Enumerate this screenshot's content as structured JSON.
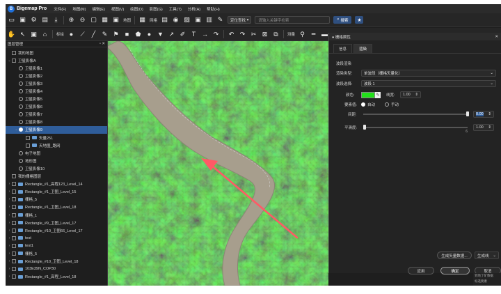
{
  "app": {
    "logo_letter": "B",
    "title": "Bigemap Pro"
  },
  "menu": [
    "文件(F)",
    "地图(M)",
    "编辑(E)",
    "视图(V)",
    "绘图(D)",
    "影图(G)",
    "工具(T)",
    "分析(A)",
    "帮助(H)"
  ],
  "toolbar1": {
    "map_label": "地图",
    "grid_label": "网格",
    "locate_select": "定位查找",
    "search_placeholder": "请输入关键字检索",
    "search_button": "搜索"
  },
  "toolbar2": {
    "mark_label": "标绘",
    "measure_label": "测量"
  },
  "sidebar": {
    "title": "图层管理",
    "tree": [
      {
        "label": "我的地图",
        "depth": 0,
        "arrow": "",
        "ctrl": "chk",
        "icon": false,
        "hl": false
      },
      {
        "label": "卫星影像A",
        "depth": 0,
        "arrow": "⌄",
        "ctrl": "chk",
        "icon": false,
        "hl": false
      },
      {
        "label": "卫星影像1",
        "depth": 1,
        "arrow": "",
        "ctrl": "rad",
        "icon": false,
        "hl": false
      },
      {
        "label": "卫星影像2",
        "depth": 1,
        "arrow": "",
        "ctrl": "rad",
        "icon": false,
        "hl": false
      },
      {
        "label": "卫星影像3",
        "depth": 1,
        "arrow": "",
        "ctrl": "rad",
        "icon": false,
        "hl": false
      },
      {
        "label": "卫星影像4",
        "depth": 1,
        "arrow": "",
        "ctrl": "rad",
        "icon": false,
        "hl": false
      },
      {
        "label": "卫星影像5",
        "depth": 1,
        "arrow": "",
        "ctrl": "rad",
        "icon": false,
        "hl": false
      },
      {
        "label": "卫星影像6",
        "depth": 1,
        "arrow": "",
        "ctrl": "rad",
        "icon": false,
        "hl": false
      },
      {
        "label": "卫星影像7",
        "depth": 1,
        "arrow": "",
        "ctrl": "rad",
        "icon": false,
        "hl": false
      },
      {
        "label": "卫星影像8",
        "depth": 1,
        "arrow": "",
        "ctrl": "rad",
        "icon": false,
        "hl": false
      },
      {
        "label": "卫星影像9",
        "depth": 1,
        "arrow": "⌄",
        "ctrl": "rad-on",
        "icon": false,
        "hl": true
      },
      {
        "label": "矢量251",
        "depth": 2,
        "arrow": "",
        "ctrl": "chk",
        "icon": true,
        "hl": false
      },
      {
        "label": "天地图_路网",
        "depth": 2,
        "arrow": "",
        "ctrl": "chk",
        "icon": true,
        "hl": false
      },
      {
        "label": "电子地图",
        "depth": 1,
        "arrow": "",
        "ctrl": "rad",
        "icon": false,
        "hl": false
      },
      {
        "label": "地形图",
        "depth": 1,
        "arrow": "",
        "ctrl": "rad",
        "icon": false,
        "hl": false
      },
      {
        "label": "卫星影像10",
        "depth": 1,
        "arrow": "",
        "ctrl": "rad",
        "icon": false,
        "hl": false
      },
      {
        "label": "我的栅格图层",
        "depth": 0,
        "arrow": "",
        "ctrl": "chk",
        "icon": false,
        "hl": false
      },
      {
        "label": "Rectangle_#1_高程123_Level_14",
        "depth": 0,
        "arrow": "›",
        "ctrl": "chk",
        "icon": true,
        "hl": false
      },
      {
        "label": "Rectangle_#1_卫图_Level_15",
        "depth": 0,
        "arrow": "›",
        "ctrl": "chk",
        "icon": true,
        "hl": false
      },
      {
        "label": "栅格_5",
        "depth": 0,
        "arrow": "›",
        "ctrl": "chk",
        "icon": true,
        "hl": false
      },
      {
        "label": "Rectangle_#1_卫图_Level_18",
        "depth": 0,
        "arrow": "›",
        "ctrl": "chk",
        "icon": true,
        "hl": false
      },
      {
        "label": "栅格_1",
        "depth": 0,
        "arrow": "›",
        "ctrl": "chk",
        "icon": true,
        "hl": false
      },
      {
        "label": "Rectangle_#9_卫图_Level_17",
        "depth": 0,
        "arrow": "›",
        "ctrl": "chk",
        "icon": true,
        "hl": false
      },
      {
        "label": "Rectangle_#10_卫图66_Level_17",
        "depth": 0,
        "arrow": "›",
        "ctrl": "chk",
        "icon": true,
        "hl": false
      },
      {
        "label": "test",
        "depth": 0,
        "arrow": "›",
        "ctrl": "chk",
        "icon": true,
        "hl": false
      },
      {
        "label": "test1",
        "depth": 0,
        "arrow": "›",
        "ctrl": "chk",
        "icon": true,
        "hl": false
      },
      {
        "label": "栅格_5",
        "depth": 0,
        "arrow": "›",
        "ctrl": "chk",
        "icon": true,
        "hl": false
      },
      {
        "label": "Rectangle_#10_卫图_Level_18",
        "depth": 0,
        "arrow": "›",
        "ctrl": "chk",
        "icon": true,
        "hl": false
      },
      {
        "label": "103E39N_COP30",
        "depth": 0,
        "arrow": "›",
        "ctrl": "chk",
        "icon": true,
        "hl": false
      },
      {
        "label": "Rectangle_#1_高程_Level_18",
        "depth": 0,
        "arrow": "›",
        "ctrl": "chk",
        "icon": true,
        "hl": false
      }
    ]
  },
  "panel": {
    "title": "栅格属性",
    "tabs": [
      "信息",
      "渲染"
    ],
    "section": "波段渲染",
    "render_type_label": "渲染类型:",
    "render_type_value": "单波段（栅格矢量化）",
    "band_label": "波段选择:",
    "band_value": "波段 1",
    "color_label": "颜色:",
    "linewidth_label": "线宽:",
    "linewidth_value": "1.00",
    "feature_label": "要素值:",
    "auto_label": "自动",
    "manual_label": "手动",
    "interval_label": "间距:",
    "interval_value": "0.00",
    "smooth_label": "平滑度:",
    "smooth_value": "1.00",
    "smooth_tick": "6",
    "gen_vector_button": "生成矢量数据...",
    "gen_line_select": "生成线",
    "apply_button": "应用",
    "ok_button": "确定",
    "cancel_button": "取消",
    "color_value": "#22e01a"
  },
  "behind_text": [
    "到地了矿数据",
    "标选要素"
  ]
}
